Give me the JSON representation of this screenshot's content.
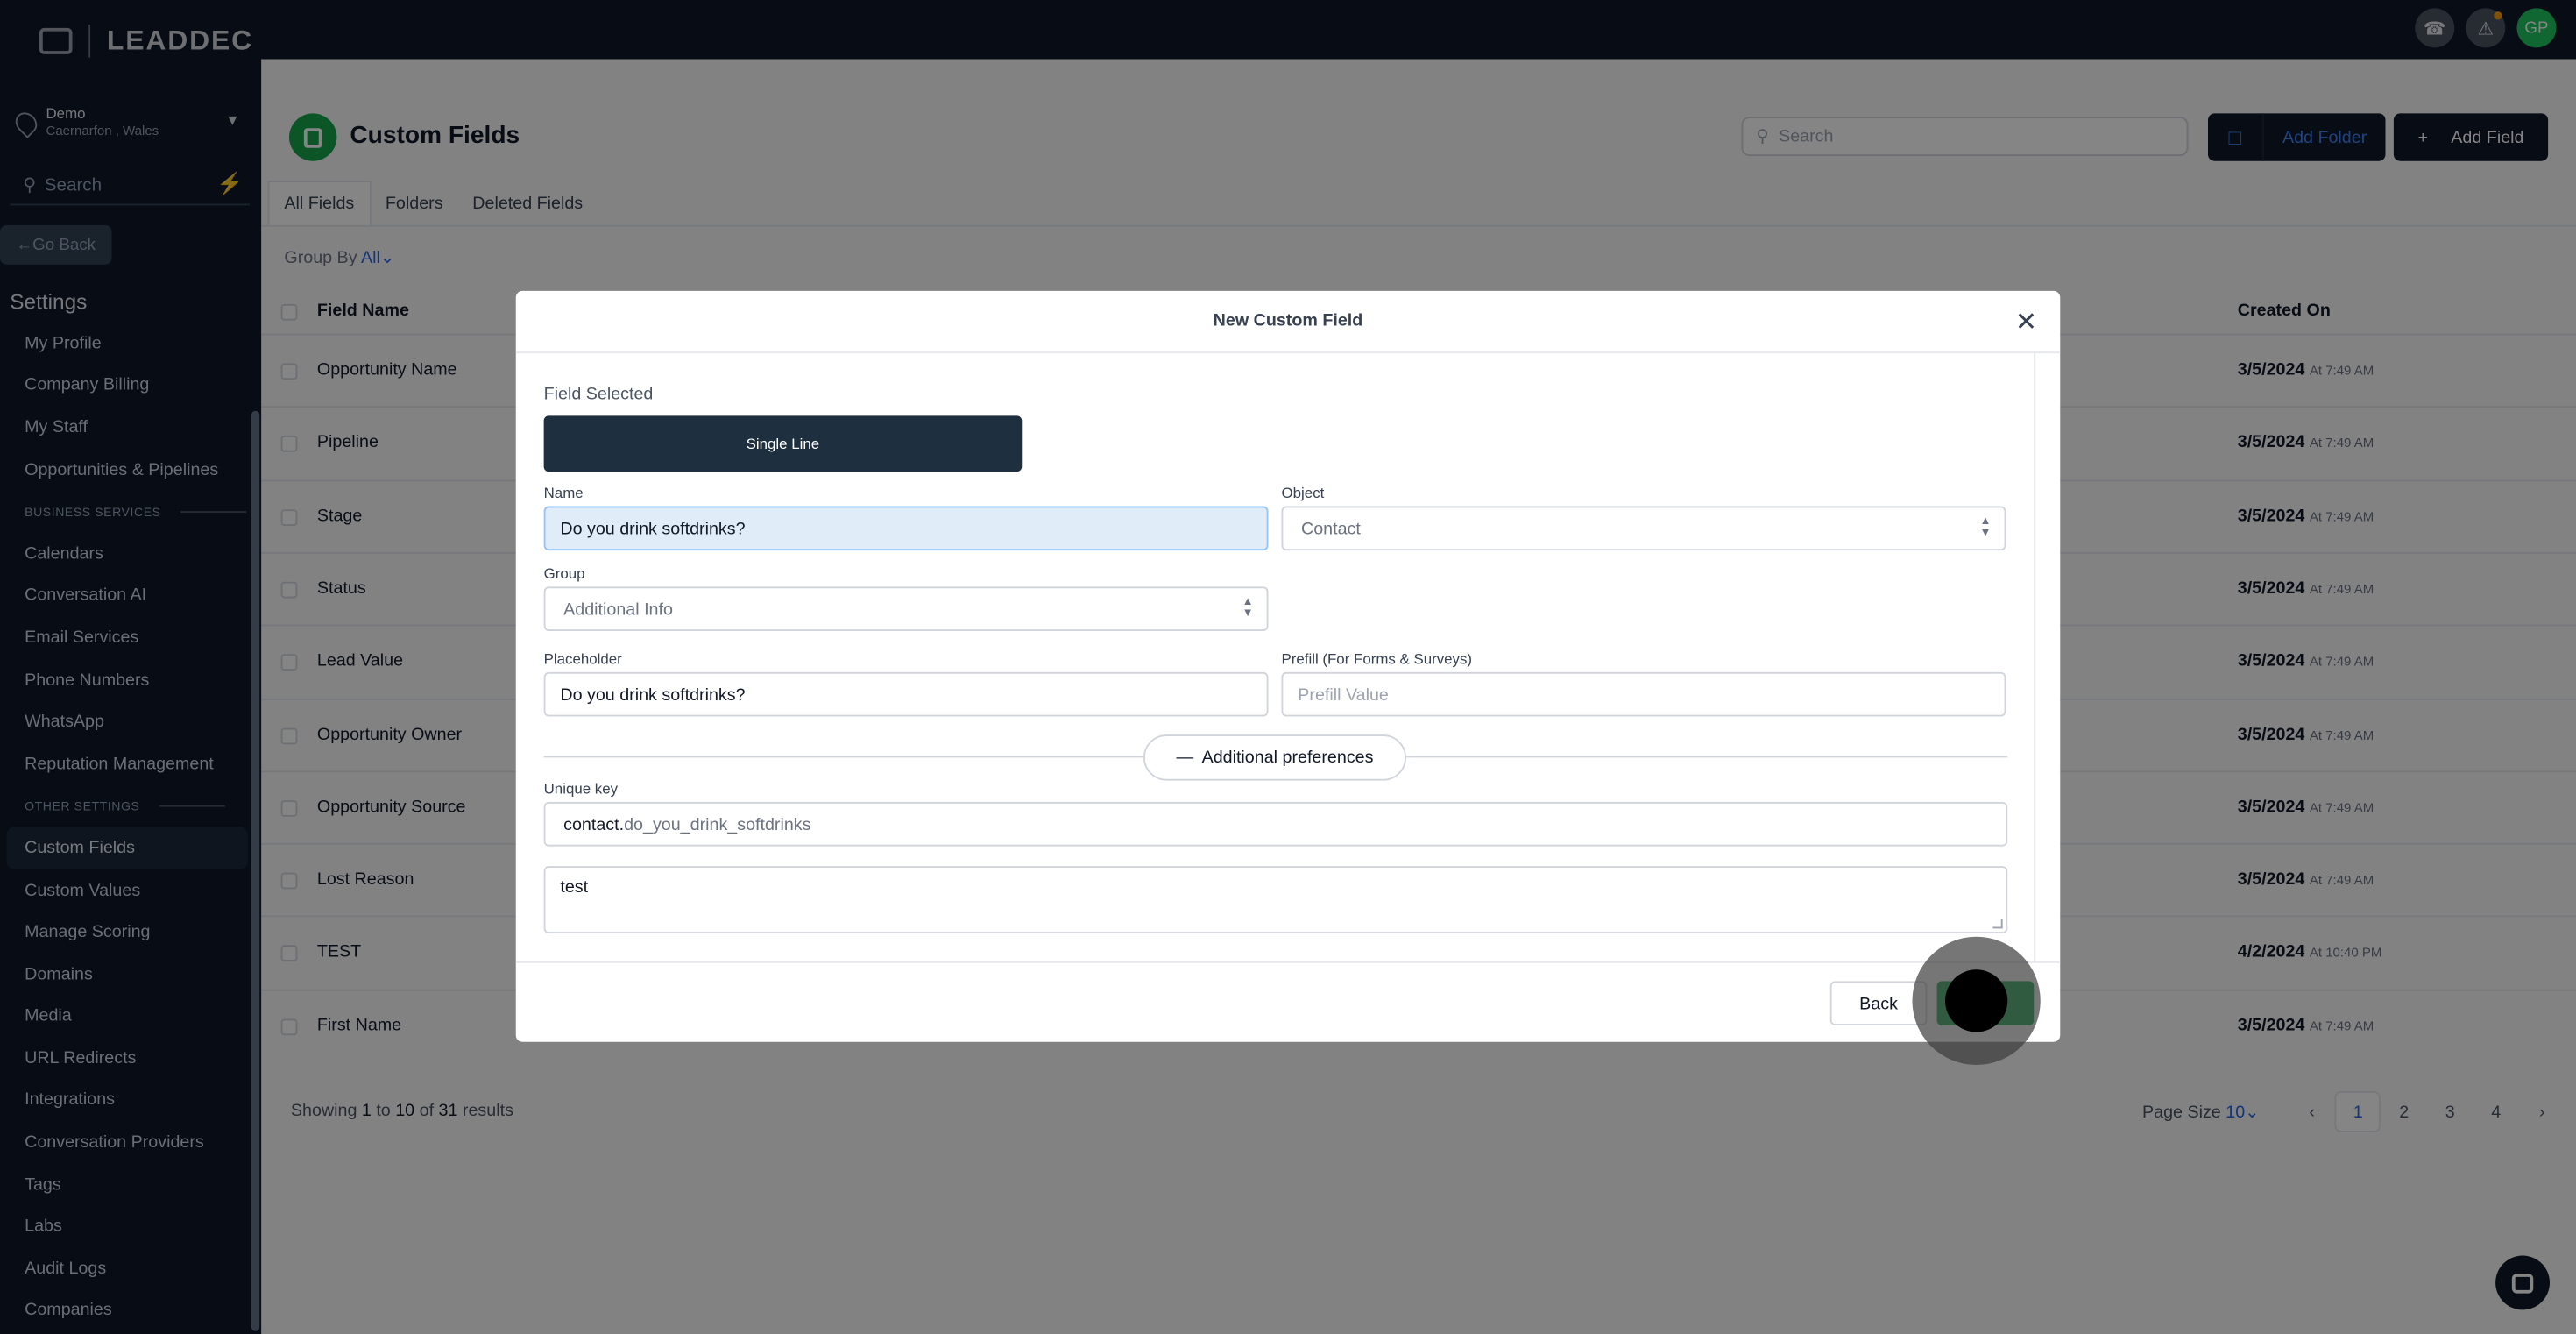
{
  "brand": {
    "logo_text": "LEADDEC"
  },
  "location": {
    "name": "Demo",
    "sub": "Caernarfon , Wales"
  },
  "sidebar": {
    "search_placeholder": "Search",
    "go_back": "Go Back",
    "settings_heading": "Settings",
    "items": [
      {
        "type": "item",
        "label": "My Profile"
      },
      {
        "type": "item",
        "label": "Company Billing"
      },
      {
        "type": "item",
        "label": "My Staff"
      },
      {
        "type": "item",
        "label": "Opportunities & Pipelines"
      },
      {
        "type": "section",
        "label": "BUSINESS SERVICES"
      },
      {
        "type": "item",
        "label": "Calendars"
      },
      {
        "type": "item",
        "label": "Conversation AI"
      },
      {
        "type": "item",
        "label": "Email Services"
      },
      {
        "type": "item",
        "label": "Phone Numbers"
      },
      {
        "type": "item",
        "label": "WhatsApp"
      },
      {
        "type": "item",
        "label": "Reputation Management"
      },
      {
        "type": "section",
        "label": "OTHER SETTINGS"
      },
      {
        "type": "item",
        "label": "Custom Fields",
        "active": true
      },
      {
        "type": "item",
        "label": "Custom Values"
      },
      {
        "type": "item",
        "label": "Manage Scoring"
      },
      {
        "type": "item",
        "label": "Domains"
      },
      {
        "type": "item",
        "label": "Media"
      },
      {
        "type": "item",
        "label": "URL Redirects"
      },
      {
        "type": "item",
        "label": "Integrations"
      },
      {
        "type": "item",
        "label": "Conversation Providers"
      },
      {
        "type": "item",
        "label": "Tags"
      },
      {
        "type": "item",
        "label": "Labs"
      },
      {
        "type": "item",
        "label": "Audit Logs"
      },
      {
        "type": "item",
        "label": "Companies"
      }
    ]
  },
  "topbar": {
    "avatar_initials": "GP"
  },
  "page": {
    "title": "Custom Fields",
    "search_placeholder": "Search",
    "add_folder": "Add Folder",
    "add_field": "Add Field",
    "tabs": [
      "All Fields",
      "Folders",
      "Deleted Fields"
    ],
    "group_by_label": "Group By",
    "group_by_value": "All"
  },
  "table": {
    "col_name": "Field Name",
    "col_created": "Created On",
    "rows": [
      {
        "name": "Opportunity Name",
        "date": "3/5/2024",
        "time": "At 7:49 AM"
      },
      {
        "name": "Pipeline",
        "date": "3/5/2024",
        "time": "At 7:49 AM"
      },
      {
        "name": "Stage",
        "date": "3/5/2024",
        "time": "At 7:49 AM"
      },
      {
        "name": "Status",
        "date": "3/5/2024",
        "time": "At 7:49 AM"
      },
      {
        "name": "Lead Value",
        "date": "3/5/2024",
        "time": "At 7:49 AM"
      },
      {
        "name": "Opportunity Owner",
        "date": "3/5/2024",
        "time": "At 7:49 AM"
      },
      {
        "name": "Opportunity Source",
        "date": "3/5/2024",
        "time": "At 7:49 AM"
      },
      {
        "name": "Lost Reason",
        "date": "3/5/2024",
        "time": "At 7:49 AM"
      },
      {
        "name": "TEST",
        "date": "4/2/2024",
        "time": "At 10:40 PM"
      },
      {
        "name": "First Name",
        "date": "3/5/2024",
        "time": "At 7:49 AM"
      }
    ]
  },
  "pagination": {
    "showing_prefix": "Showing",
    "from": "1",
    "to_word": "to",
    "to": "10",
    "of_word": "of",
    "total": "31",
    "results_word": "results",
    "page_size_label": "Page Size",
    "page_size_value": "10",
    "pages": [
      "1",
      "2",
      "3",
      "4"
    ]
  },
  "modal": {
    "title": "New Custom Field",
    "field_selected_label": "Field Selected",
    "field_type": "Single Line",
    "name_label": "Name",
    "name_value": "Do you drink softdrinks?",
    "object_label": "Object",
    "object_value": "Contact",
    "group_label": "Group",
    "group_value": "Additional Info",
    "placeholder_label": "Placeholder",
    "placeholder_value": "Do you drink softdrinks?",
    "prefill_label": "Prefill (For Forms & Surveys)",
    "prefill_placeholder": "Prefill Value",
    "additional_prefs": "Additional preferences",
    "unique_key_label": "Unique key",
    "unique_key_prefix": "contact.",
    "unique_key_value": "do_you_drink_softdrinks",
    "description_value": "test",
    "back_label": "Back"
  }
}
